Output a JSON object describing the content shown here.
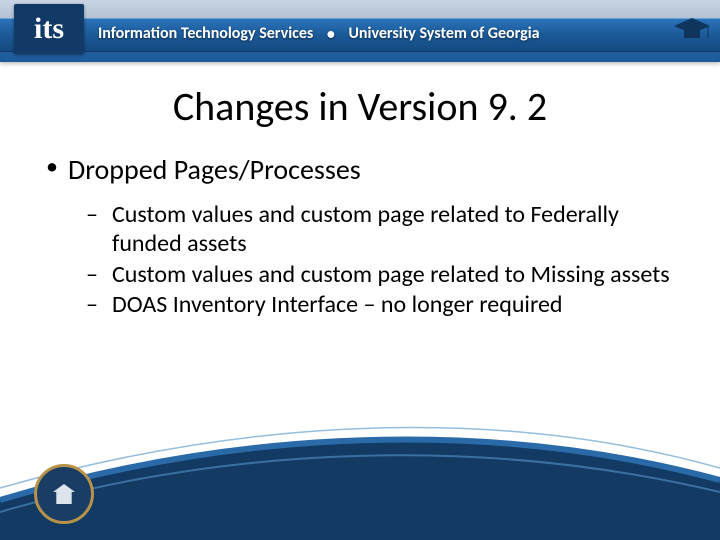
{
  "header": {
    "logo_text": "its",
    "org_left": "Information Technology Services",
    "org_right": "University System of Georgia"
  },
  "title": "Changes in Version 9. 2",
  "body": {
    "heading": "Dropped Pages/Processes",
    "items": [
      "Custom values and custom page related to Federally funded assets",
      "Custom values and custom page related to Missing assets",
      "DOAS Inventory Interface – no longer required"
    ]
  }
}
